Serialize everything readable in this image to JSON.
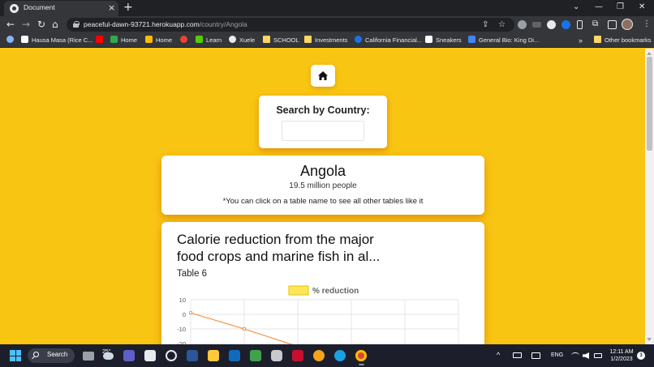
{
  "browser": {
    "tab": {
      "title": "Document",
      "close": "×"
    },
    "new_tab": "+",
    "window_controls": {
      "dropdown": "⌄",
      "minimize": "—",
      "restore": "❐",
      "close": "✕"
    },
    "nav": {
      "back": "←",
      "forward": "→",
      "reload": "↻",
      "home": "⌂"
    },
    "url": {
      "host": "peaceful-dawn-93721.herokuapp.com",
      "path": "/country/Angola"
    },
    "toolbar_icons": {
      "share": "⇪",
      "star": "☆",
      "extensions": "⧉",
      "menu": "⋮"
    },
    "bookmarks": [
      {
        "label": "Hausa Masa (Rice C...",
        "icon": "video-icon",
        "color": "#ffffff"
      },
      {
        "label": "Home",
        "icon": "grid-icon",
        "color": "#34a853"
      },
      {
        "label": "Learn",
        "icon": "owl-icon",
        "color": "#58cc02"
      },
      {
        "label": "Xuele",
        "icon": "globe-icon",
        "color": "#e8eaed"
      },
      {
        "label": "SCHOOL",
        "icon": "folder-icon",
        "color": "#fdd663"
      },
      {
        "label": "Investments",
        "icon": "folder-icon",
        "color": "#fdd663"
      },
      {
        "label": "California Financial...",
        "icon": "cloud-icon",
        "color": "#1a73e8"
      },
      {
        "label": "Sneakers",
        "icon": "m-icon",
        "color": "#ffffff"
      },
      {
        "label": "General Bio: King Di...",
        "icon": "doc-icon",
        "color": "#4285f4"
      }
    ],
    "bookmarks_more": "»",
    "other_bookmarks": "Other bookmarks"
  },
  "page": {
    "search": {
      "label": "Search by Country:",
      "value": "",
      "placeholder": ""
    },
    "country": {
      "name": "Angola",
      "population": "19.5 million people",
      "hint": "*You can click on a table name to see all other tables like it"
    },
    "table": {
      "title_line1": "Calorie reduction from the major",
      "title_line2": "food crops and marine fish in al...",
      "subtitle": "Table 6"
    }
  },
  "chart_data": {
    "type": "line",
    "series": [
      {
        "name": "% reduction",
        "color": "#f4822a",
        "fill": "#ffe55c",
        "values": [
          1,
          -10,
          -22
        ]
      }
    ],
    "x": [
      "",
      "",
      "",
      "",
      "",
      ""
    ],
    "ytick_labels": [
      "10",
      "0",
      "-10",
      "-20"
    ],
    "ylim": [
      -20,
      10
    ],
    "legend": "top-center",
    "grid": true
  },
  "taskbar": {
    "search_label": "Search",
    "weather": "25°",
    "language": "ENG",
    "time": "12:11 AM",
    "date": "1/2/2023",
    "notifications": "3",
    "chevron": "^"
  }
}
